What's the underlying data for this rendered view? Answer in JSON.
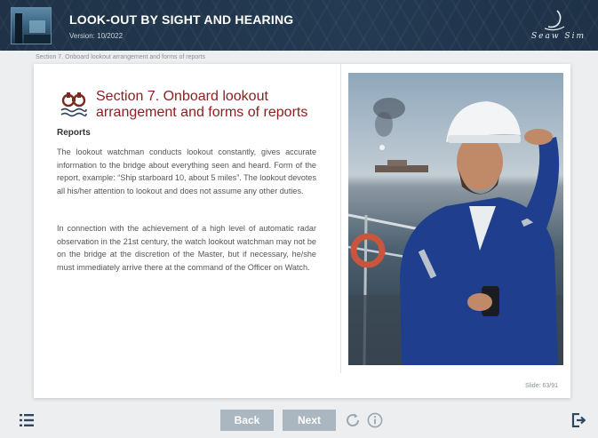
{
  "header": {
    "title": "LOOK-OUT BY SIGHT AND HEARING",
    "version": "Version: 10/2022",
    "logo_text": "Seaw Sim"
  },
  "breadcrumb": "Section 7. Onboard lookout arrangement and forms of reports",
  "slide": {
    "section_title": "Section 7. Onboard lookout arrangement and forms of reports",
    "subheading": "Reports",
    "paragraphs": [
      "The lookout watchman conducts lookout constantly, gives accurate information to the bridge about everything seen and heard. Form of the report, example: “Ship starboard 10, about 5 miles”. The lookout devotes all his/her attention to lookout and does not assume any other duties.",
      "In connection with the achievement of a high level of automatic radar observation in the 21st century, the watch lookout watchman may not be on the bridge at the discretion of the Master, but if necessary, he/she must immediately arrive there at the command of the Officer on Watch."
    ],
    "slide_number": "Slide: 63/91"
  },
  "footer": {
    "back_label": "Back",
    "next_label": "Next"
  },
  "icons": {
    "menu": "menu-list-icon",
    "reload": "reload-icon",
    "info": "info-icon",
    "exit": "exit-icon",
    "section": "binoculars-icon"
  },
  "colors": {
    "header_bg": "#233a52",
    "title_accent": "#8b2020",
    "button_bg": "#aab6c0",
    "icon_color": "#2e4660"
  }
}
